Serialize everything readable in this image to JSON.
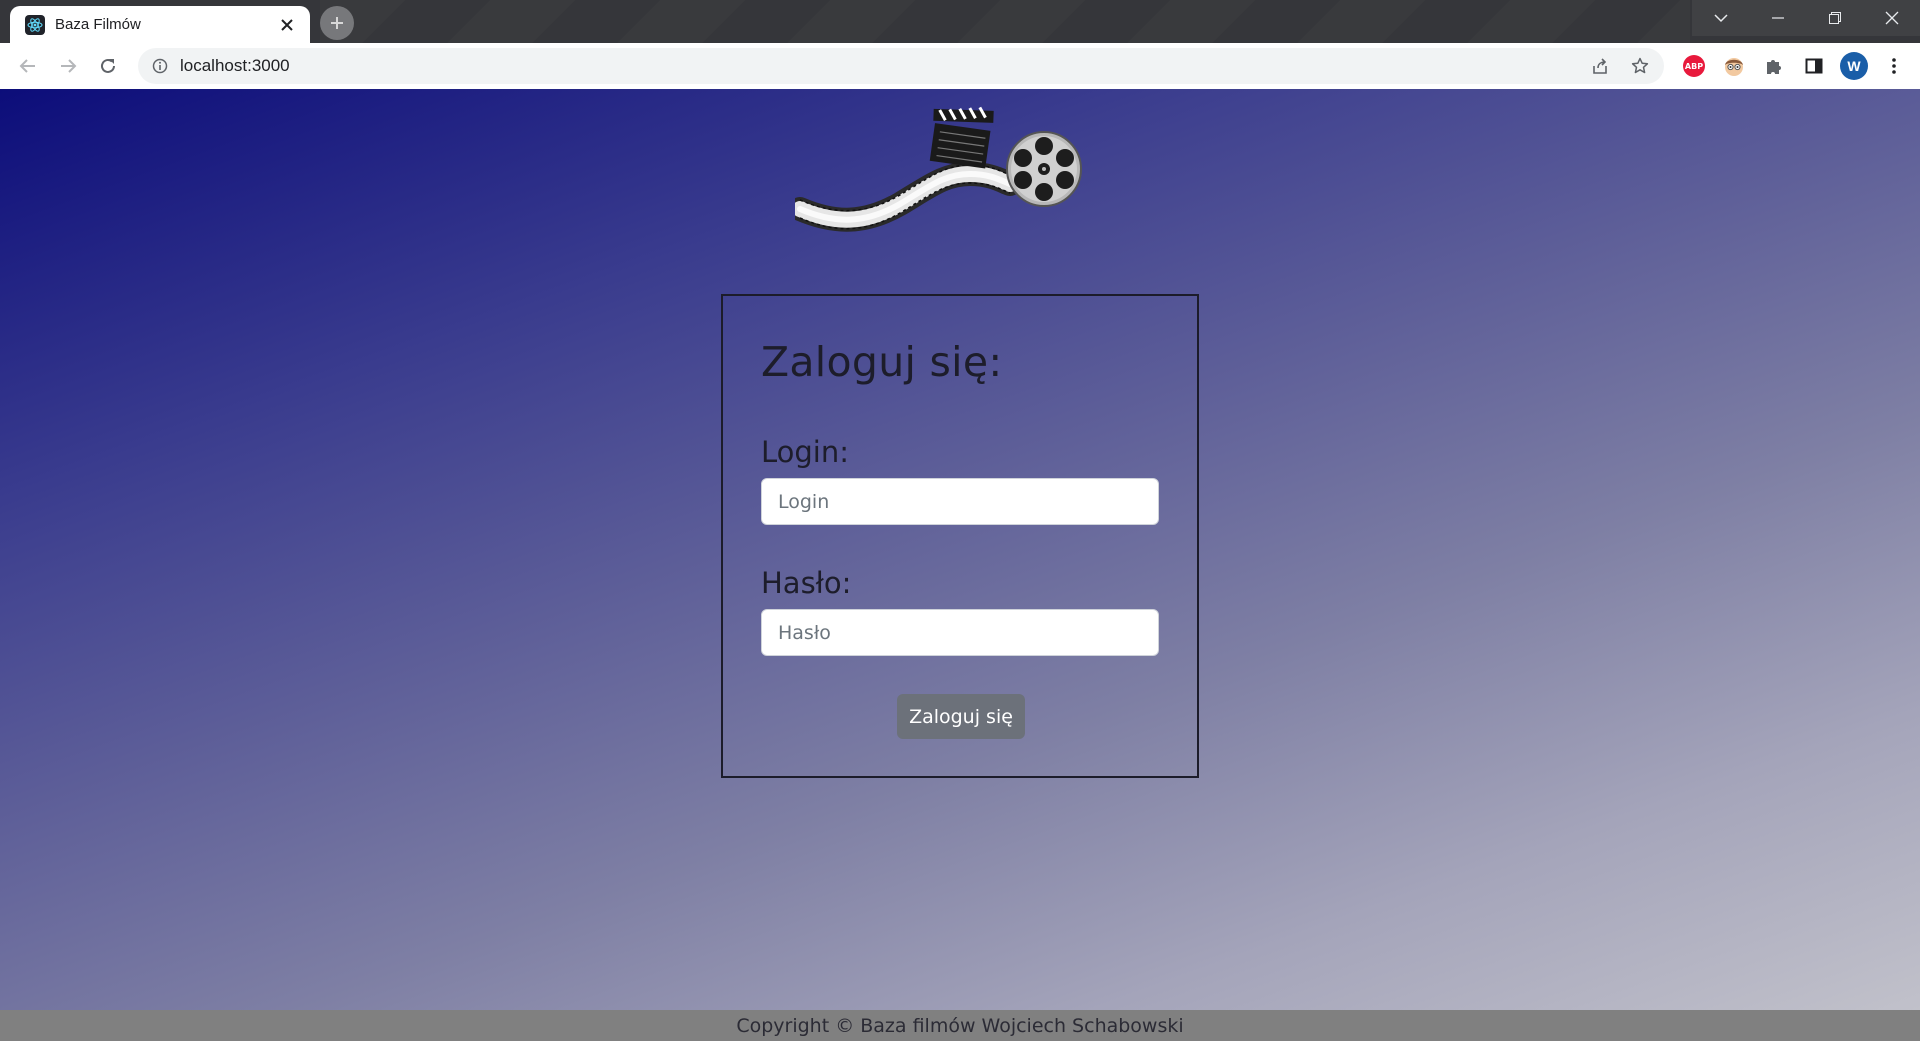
{
  "browser": {
    "tab": {
      "title": "Baza Filmów",
      "favicon": "react-atom-icon",
      "close_glyph": "✕"
    },
    "new_tab_glyph": "+",
    "address_bar": {
      "url": "localhost:3000"
    },
    "avatar_initial": "W",
    "extension_abp_label": "ABP"
  },
  "page": {
    "logo_alt": "film-logo",
    "login_form": {
      "title": "Zaloguj się:",
      "login_label": "Login:",
      "login_placeholder": "Login",
      "login_value": "",
      "password_label": "Hasło:",
      "password_placeholder": "Hasło",
      "password_value": "",
      "submit_label": "Zaloguj się"
    },
    "footer": {
      "text": "Copyright © Baza filmów Wojciech Schabowski"
    }
  },
  "colors": {
    "gradient_start": "#0c0d7a",
    "gradient_end": "#c4c4cc",
    "footer_bg": "#808080",
    "button_bg": "#6c717a"
  }
}
